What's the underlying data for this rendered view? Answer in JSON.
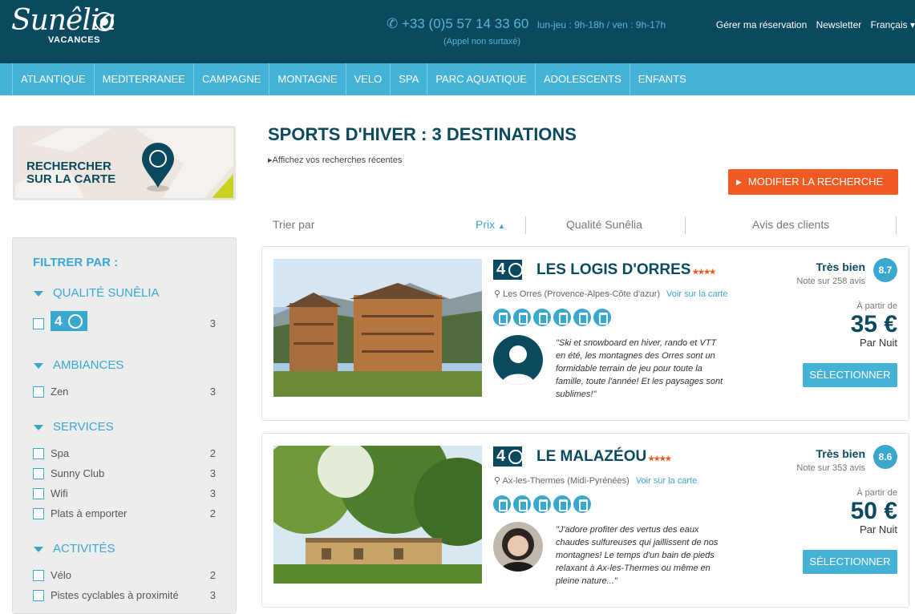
{
  "header": {
    "logo_text": "Sunêlia",
    "logo_sub": "VACANCES",
    "phone": "+33 (0)5 57 14 33 60",
    "hours": "lun-jeu : 9h-18h / ven : 9h-17h",
    "phone_note": "(Appel non surtaxé)",
    "links": [
      "Gérer ma réservation",
      "Newsletter",
      "Français"
    ]
  },
  "nav": [
    "ATLANTIQUE",
    "MEDITERRANEE",
    "CAMPAGNE",
    "MONTAGNE",
    "VELO",
    "SPA",
    "PARC AQUATIQUE",
    "ADOLESCENTS",
    "ENFANTS"
  ],
  "map_card": {
    "label_line1": "RECHERCHER",
    "label_line2": "SUR LA CARTE"
  },
  "filters": {
    "title": "FILTRER PAR :",
    "sections": [
      {
        "name": "QUALITÉ SUNÊLIA",
        "items": [
          {
            "label": "4",
            "count": "3"
          }
        ]
      },
      {
        "name": "AMBIANCES",
        "items": [
          {
            "label": "Zen",
            "count": "3"
          }
        ]
      },
      {
        "name": "SERVICES",
        "items": [
          {
            "label": "Spa",
            "count": "2"
          },
          {
            "label": "Sunny Club",
            "count": "3"
          },
          {
            "label": "Wifi",
            "count": "3"
          },
          {
            "label": "Plats à emporter",
            "count": "2"
          }
        ]
      },
      {
        "name": "ACTIVITÉS",
        "items": [
          {
            "label": "Vélo",
            "count": "2"
          },
          {
            "label": "Pistes cyclables à proximité",
            "count": "3"
          }
        ]
      }
    ]
  },
  "main": {
    "title": "SPORTS D'HIVER : 3 DESTINATIONS",
    "recent_link": "Affichez vos recherches récentes",
    "modify_button": "MODIFIER LA RECHERCHE",
    "sort": {
      "label": "Trier par",
      "options": [
        "Prix",
        "Qualité Sunêlia",
        "Avis des clients"
      ]
    }
  },
  "results": [
    {
      "grade": "4",
      "name": "LES LOGIS D'ORRES",
      "stars": "★★★★",
      "location": "Les Orres (Provence-Alpes-Côte d'azur)",
      "map_link": "Voir sur la carte",
      "quote": "\"Ski et snowboard en hiver, rando et VTT en été, les montagnes des Orres sont un formidable terrain de jeu pour toute la famille, toute l'année! Et les paysages sont sublimes!\"",
      "rating_label": "Très bien",
      "rating_sub": "Note sur 258 avis",
      "score": "8.7",
      "from": "À partir de",
      "price": "35 €",
      "per": "Par Nuit",
      "button": "SÉLECTIONNER"
    },
    {
      "grade": "4",
      "name": "LE MALAZÉOU",
      "stars": "★★★★",
      "location": "Ax-les-Thermes (Midi-Pyrénées)",
      "map_link": "Voir sur la carte",
      "quote": "\"J'adore profiter des vertus des eaux chaudes sulfureuses qui jaillissent de nos montagnes! Le temps d'un bain de pieds relaxant à Ax-les-Thermes ou même en pleine nature...\"",
      "rating_label": "Très bien",
      "rating_sub": "Note sur 353 avis",
      "score": "8.6",
      "from": "À partir de",
      "price": "50 €",
      "per": "Par Nuit",
      "button": "SÉLECTIONNER"
    }
  ]
}
